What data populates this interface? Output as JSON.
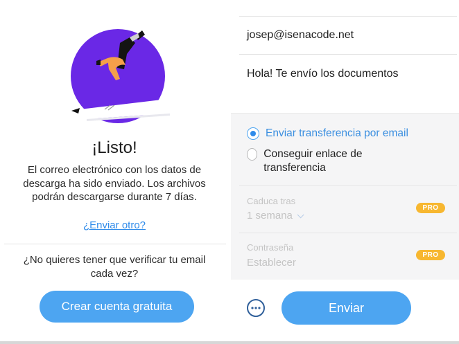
{
  "done": {
    "title": "¡Listo!",
    "description": "El correo electrónico con los datos de descarga ha sido enviado. Los archivos podrán descargarse durante 7 días.",
    "resend_link": "¿Enviar otro?",
    "question": "¿No quieres tener que verificar tu email cada vez?",
    "create_account_button": "Crear cuenta gratuita"
  },
  "transfer_form": {
    "email": "josep@isenacode.net",
    "message": "Hola! Te envío los documentos",
    "options": [
      {
        "label": "Enviar transferencia por email",
        "selected": true
      },
      {
        "label": "Conseguir enlace de transferencia",
        "selected": false
      }
    ],
    "expires_label": "Caduca tras",
    "expires_value": "1 semana",
    "password_label": "Contraseña",
    "password_placeholder": "Establecer",
    "pro_badge": "PRO",
    "send_button": "Enviar"
  },
  "icons": [
    "celebration-illustration",
    "radio-checked-icon",
    "radio-unchecked-icon",
    "chevron-down-icon",
    "more-options-icon"
  ],
  "colors": {
    "accent": "#4da5f1",
    "link": "#2f8bea",
    "pro_badge": "#f7b730",
    "illustration_circle": "#6a28e6",
    "panel_gray": "#f5f5f6"
  }
}
